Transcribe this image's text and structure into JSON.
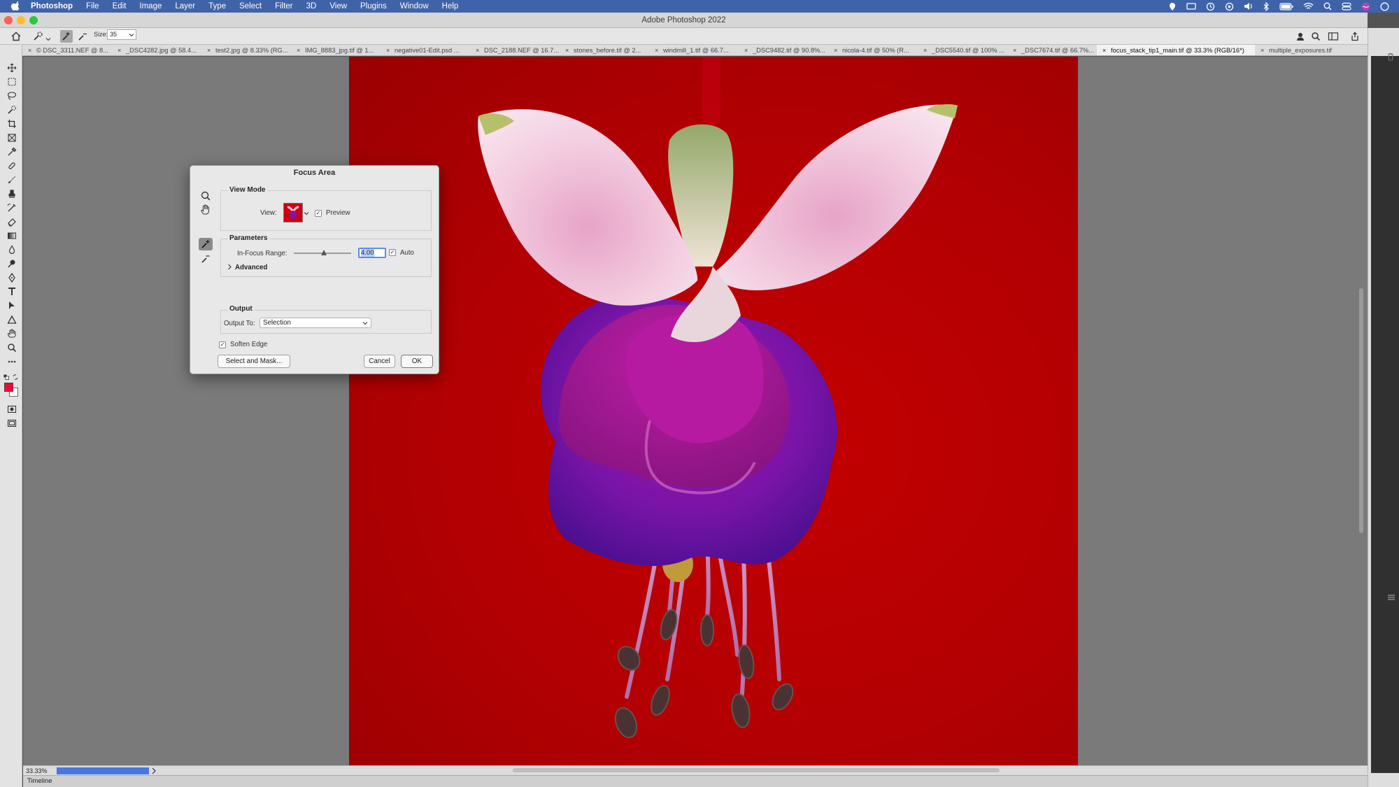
{
  "menubar": {
    "app_name": "Photoshop",
    "items": [
      "File",
      "Edit",
      "Image",
      "Layer",
      "Type",
      "Select",
      "Filter",
      "3D",
      "View",
      "Plugins",
      "Window",
      "Help"
    ]
  },
  "window": {
    "title": "Adobe Photoshop 2022"
  },
  "options_bar": {
    "size_label": "Size:",
    "size_value": "35"
  },
  "tabs": [
    "© DSC_3311.NEF @ 8...",
    "_DSC4282.jpg @ 58.4...",
    "test2.jpg @ 8.33% (RG...",
    "IMG_8883_jpg.tif @ 1...",
    "negative01-Edit.psd ...",
    "DSC_2188.NEF @ 16.7...",
    "stones_before.tif @ 2...",
    "windmill_1.tif @ 66.7...",
    "_DSC9482.tif @ 90.8%...",
    "nicola-4.tif @ 50% (R...",
    "_DSC5540.tif @ 100% ...",
    "_DSC7674.tif @ 66.7%...",
    "focus_stack_tip1_main.tif @ 33.3% (RGB/16*)",
    "multiple_exposures.tif"
  ],
  "active_tab_index": 12,
  "dialog": {
    "title": "Focus Area",
    "view_mode": {
      "heading": "View Mode",
      "view_label": "View:",
      "preview_label": "Preview",
      "preview_checked": true
    },
    "parameters": {
      "heading": "Parameters",
      "range_label": "In-Focus Range:",
      "range_value": "4.00",
      "range_fraction": 0.52,
      "auto_label": "Auto",
      "auto_checked": true,
      "advanced_label": "Advanced"
    },
    "output": {
      "heading": "Output",
      "output_to_label": "Output To:",
      "output_to_value": "Selection",
      "soften_edge_label": "Soften Edge",
      "soften_edge_checked": true
    },
    "buttons": {
      "select_and_mask": "Select and Mask...",
      "cancel": "Cancel",
      "ok": "OK"
    }
  },
  "status": {
    "zoom": "33.33%",
    "timeline_label": "Timeline"
  },
  "colors": {
    "menubar": "#3f63a8",
    "foreground_swatch": "#ff0033",
    "background_swatch": "#ffffff",
    "image_background": "#b80003",
    "accent": "#4778e0"
  }
}
